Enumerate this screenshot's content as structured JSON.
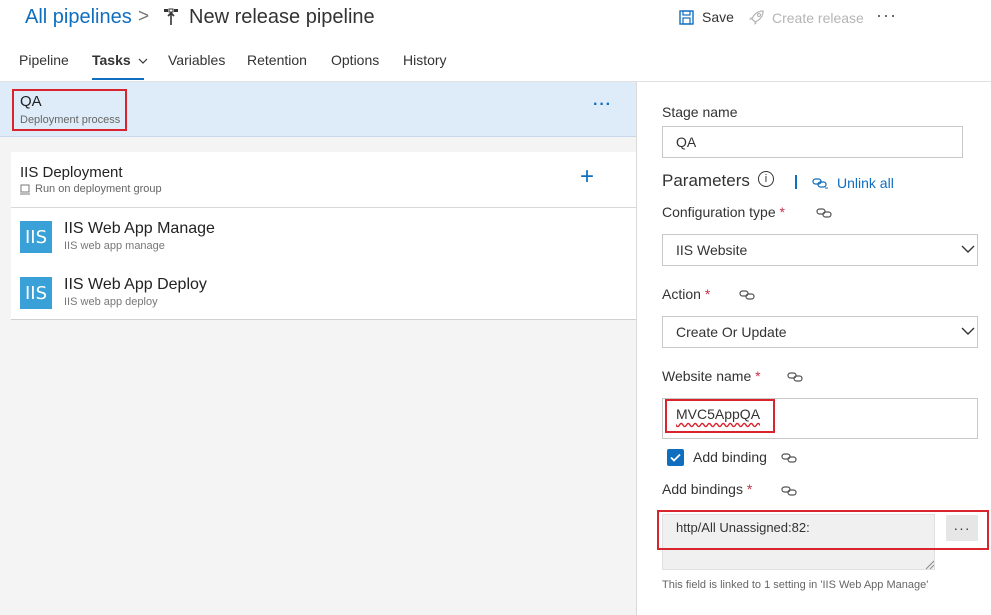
{
  "header": {
    "breadcrumb": "All pipelines",
    "separator": ">",
    "title": "New release pipeline",
    "save_label": "Save",
    "create_release_label": "Create release",
    "more_label": "···"
  },
  "tabs": [
    {
      "label": "Pipeline"
    },
    {
      "label": "Tasks"
    },
    {
      "label": "Variables"
    },
    {
      "label": "Retention"
    },
    {
      "label": "Options"
    },
    {
      "label": "History"
    }
  ],
  "left": {
    "stage": {
      "name": "QA",
      "subtitle": "Deployment process",
      "more": "···"
    },
    "group": {
      "title": "IIS Deployment",
      "subtitle": "Run on deployment group",
      "add": "+"
    },
    "tasks": [
      {
        "icon": "IIS",
        "name": "IIS Web App Manage",
        "subtitle": "IIS web app manage"
      },
      {
        "icon": "IIS",
        "name": "IIS Web App Deploy",
        "subtitle": "IIS web app deploy"
      }
    ]
  },
  "right": {
    "stage_name_label": "Stage name",
    "stage_name_value": "QA",
    "parameters_title": "Parameters",
    "info_glyph": "i",
    "unlink_all": "Unlink all",
    "configuration_type_label": "Configuration type",
    "configuration_type_value": "IIS Website",
    "action_label": "Action",
    "action_value": "Create Or Update",
    "website_name_label": "Website name",
    "website_name_value": "MVC5AppQA",
    "add_binding_label": "Add binding",
    "add_binding_checked": true,
    "add_bindings_label": "Add bindings",
    "add_bindings_value": "http/All Unassigned:82:",
    "bindings_more": "···",
    "required_mark": "*",
    "linked_hint": "This field is linked to 1 setting in 'IIS Web App Manage'"
  },
  "colors": {
    "accent": "#106ebe",
    "highlight": "#d9232d",
    "stage_bg": "#deecf9"
  }
}
